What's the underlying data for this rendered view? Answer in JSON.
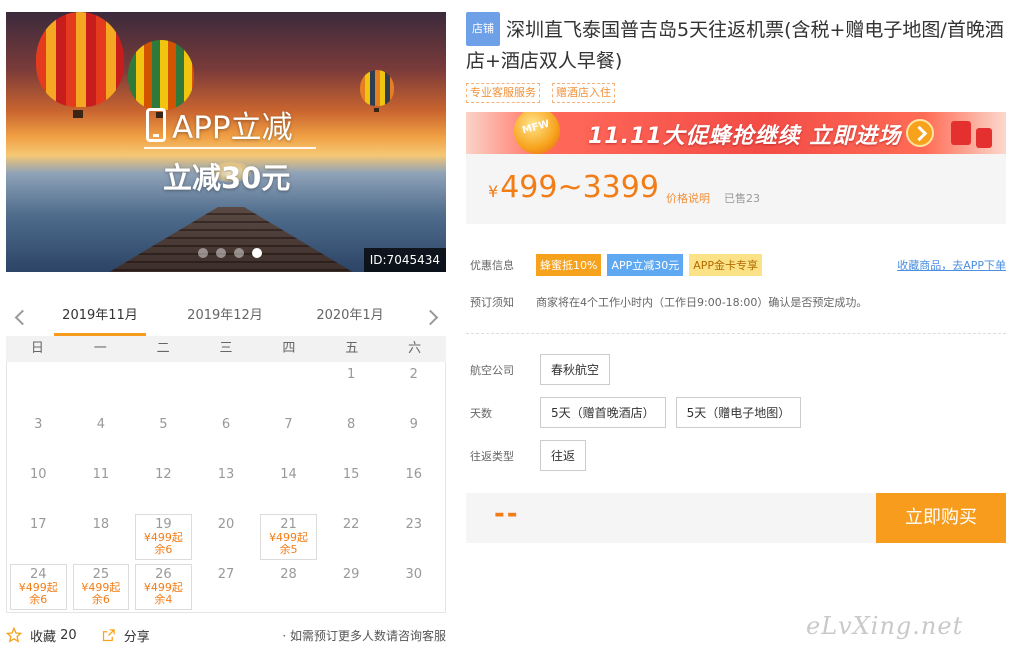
{
  "hero": {
    "app_label": "APP立减",
    "discount_label": "立减30元",
    "id_label": "ID:7045434",
    "slides": 4,
    "active_slide": 4
  },
  "calendar": {
    "months": [
      "2019年11月",
      "2019年12月",
      "2020年1月"
    ],
    "active_month": "2019年11月",
    "weekdays": [
      "日",
      "一",
      "二",
      "三",
      "四",
      "五",
      "六"
    ],
    "first_weekday": 5,
    "days": 30,
    "available": [
      {
        "day": 19,
        "price": "¥499起",
        "remain": "余6"
      },
      {
        "day": 21,
        "price": "¥499起",
        "remain": "余5"
      },
      {
        "day": 24,
        "price": "¥499起",
        "remain": "余6"
      },
      {
        "day": 25,
        "price": "¥499起",
        "remain": "余6"
      },
      {
        "day": 26,
        "price": "¥499起",
        "remain": "余4"
      }
    ]
  },
  "footer": {
    "favorite_label": "收藏",
    "favorite_count": "20",
    "share_label": "分享",
    "note": "· 如需预订更多人数请咨询客服"
  },
  "product": {
    "store_badge": "店铺",
    "title": "深圳直飞泰国普吉岛5天往返机票(含税+赠电子地图/首晚酒店+酒店双人早餐)",
    "tags": [
      "专业客服服务",
      "赠酒店入住"
    ],
    "promo_text": "11.11大促蜂抢继续  立即进场",
    "price_currency": "¥",
    "price_range": "499~3399",
    "price_note": "价格说明",
    "sold": "已售23"
  },
  "offers": {
    "label": "优惠信息",
    "coupons": [
      "蜂蜜抵10%",
      "APP立减30元",
      "APP金卡专享"
    ],
    "favorite_link": "收藏商品，去APP下单"
  },
  "booking": {
    "label": "预订须知",
    "text": "商家将在4个工作小时内（工作日9:00-18:00）确认是否预定成功。"
  },
  "options": {
    "airline": {
      "label": "航空公司",
      "values": [
        "春秋航空"
      ]
    },
    "days": {
      "label": "天数",
      "values": [
        "5天（赠首晚酒店）",
        "5天（赠电子地图）"
      ]
    },
    "trip_type": {
      "label": "往返类型",
      "values": [
        "往返"
      ]
    }
  },
  "buy": {
    "qty_placeholder": "--",
    "button": "立即购买"
  },
  "watermark": "eLvXing.net",
  "colors": {
    "accent": "#f79c1d",
    "price": "#f27d16",
    "link": "#4b8fe0"
  }
}
